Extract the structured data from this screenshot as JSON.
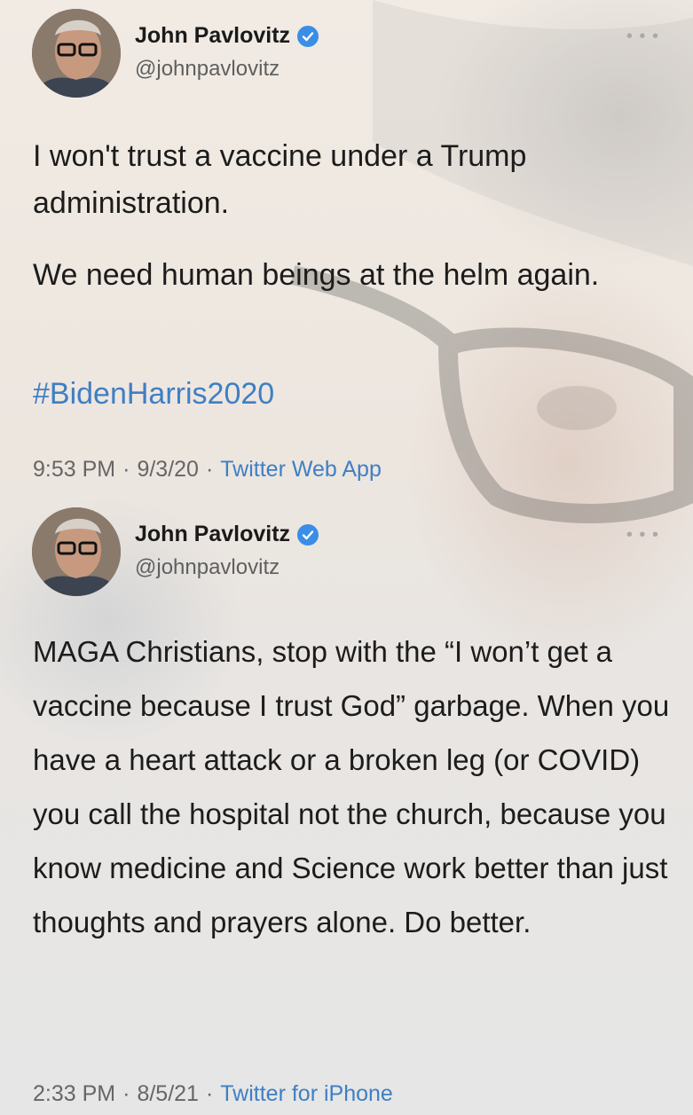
{
  "tweets": [
    {
      "author_name": "John Pavlovitz",
      "handle": "@johnpavlovitz",
      "more_icon": "ellipsis-icon",
      "paragraphs": [
        "I won't trust a vaccine under a Trump administration.",
        "We need human beings at the helm again."
      ],
      "hashtag": "#BidenHarris2020",
      "time": "9:53 PM",
      "date": "9/3/20",
      "source": "Twitter Web App"
    },
    {
      "author_name": "John Pavlovitz",
      "handle": "@johnpavlovitz",
      "more_icon": "ellipsis-icon",
      "paragraphs": [
        "MAGA Christians, stop with the “I won’t get a vaccine because I trust God” garbage. When you have a heart attack or a broken leg (or COVID) you call the hospital not the church, because you know medicine and Science work better than just thoughts and prayers alone. Do better."
      ],
      "time": "2:33 PM",
      "date": "8/5/21",
      "source": "Twitter for iPhone"
    }
  ],
  "separator": "·",
  "colors": {
    "link": "#3f7fc4",
    "verified": "#3a8ee6",
    "text": "#1c1c1c",
    "meta": "#666666"
  }
}
